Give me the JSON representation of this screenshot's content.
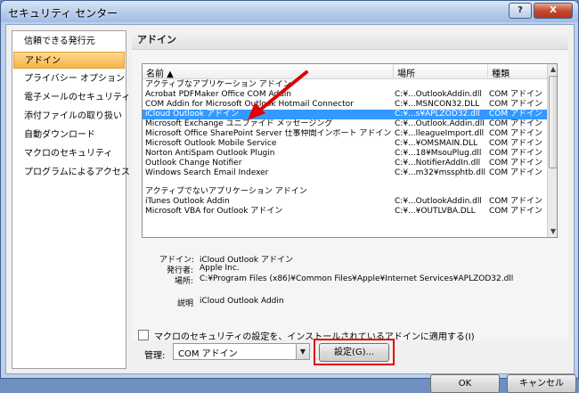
{
  "window": {
    "title": "セキュリティ センター",
    "help_label": "?",
    "close_label": "X"
  },
  "nav": {
    "items": [
      {
        "label": "信頼できる発行元",
        "selected": false
      },
      {
        "label": "アドイン",
        "selected": true
      },
      {
        "label": "プライバシー オプション",
        "selected": false
      },
      {
        "label": "電子メールのセキュリティ",
        "selected": false
      },
      {
        "label": "添付ファイルの取り扱い",
        "selected": false
      },
      {
        "label": "自動ダウンロード",
        "selected": false
      },
      {
        "label": "マクロのセキュリティ",
        "selected": false
      },
      {
        "label": "プログラムによるアクセス",
        "selected": false
      }
    ]
  },
  "panel": {
    "title": "アドイン",
    "columns": {
      "name": "名前 ▲",
      "location": "場所",
      "type": "種類"
    },
    "active_section": "アクティブなアプリケーション アドイン",
    "active_rows": [
      {
        "name": "Acrobat PDFMaker Office COM Addin",
        "location": "C:¥...OutlookAddin.dll",
        "type": "COM アドイン",
        "selected": false
      },
      {
        "name": "COM Addin for Microsoft Outlook Hotmail Connector",
        "location": "C:¥...MSNCON32.DLL",
        "type": "COM アドイン",
        "selected": false
      },
      {
        "name": "iCloud Outlook アドイン",
        "location": "C:¥...s¥APLZOD32.dll",
        "type": "COM アドイン",
        "selected": true
      },
      {
        "name": "Microsoft Exchange ユニファイド メッセージング",
        "location": "C:¥...Outlook.Addin.dll",
        "type": "COM アドイン",
        "selected": false
      },
      {
        "name": "Microsoft Office SharePoint Server 仕事仲間インポート アドイン",
        "location": "C:¥...lleagueImport.dll",
        "type": "COM アドイン",
        "selected": false
      },
      {
        "name": "Microsoft Outlook Mobile Service",
        "location": "C:¥...¥OMSMAIN.DLL",
        "type": "COM アドイン",
        "selected": false
      },
      {
        "name": "Norton AntiSpam Outlook Plugin",
        "location": "C:¥...18¥MsouPlug.dll",
        "type": "COM アドイン",
        "selected": false
      },
      {
        "name": "Outlook Change Notifier",
        "location": "C:¥...NotifierAddIn.dll",
        "type": "COM アドイン",
        "selected": false
      },
      {
        "name": "Windows Search Email Indexer",
        "location": "C:¥...m32¥mssphtb.dll",
        "type": "COM アドイン",
        "selected": false
      }
    ],
    "inactive_section": "アクティブでないアプリケーション アドイン",
    "inactive_rows": [
      {
        "name": "iTunes Outlook Addin",
        "location": "C:¥...OutlookAddin.dll",
        "type": "COM アドイン",
        "selected": false
      },
      {
        "name": "Microsoft VBA for Outlook アドイン",
        "location": "C:¥...¥OUTLVBA.DLL",
        "type": "COM アドイン",
        "selected": false
      }
    ],
    "details": {
      "addin_label": "アドイン:",
      "addin_value": "iCloud Outlook アドイン",
      "publisher_label": "発行者:",
      "publisher_value": "Apple Inc.",
      "location_label": "場所:",
      "location_value": "C:¥Program Files (x86)¥Common Files¥Apple¥Internet Services¥APLZOD32.dll",
      "desc_label": "説明",
      "desc_value": "iCloud Outlook Addin"
    },
    "macro_checkbox_label": "マクロのセキュリティの設定を、インストールされているアドインに適用する(I)",
    "macro_checkbox_checked": false
  },
  "manage": {
    "label": "管理:",
    "selected": "COM アドイン"
  },
  "buttons": {
    "settings": "設定(G)...",
    "ok": "OK",
    "cancel": "キャンセル"
  },
  "colors": {
    "selection": "#3399ff",
    "nav_selected": "#f6b34a",
    "annotation": "#e00000"
  }
}
